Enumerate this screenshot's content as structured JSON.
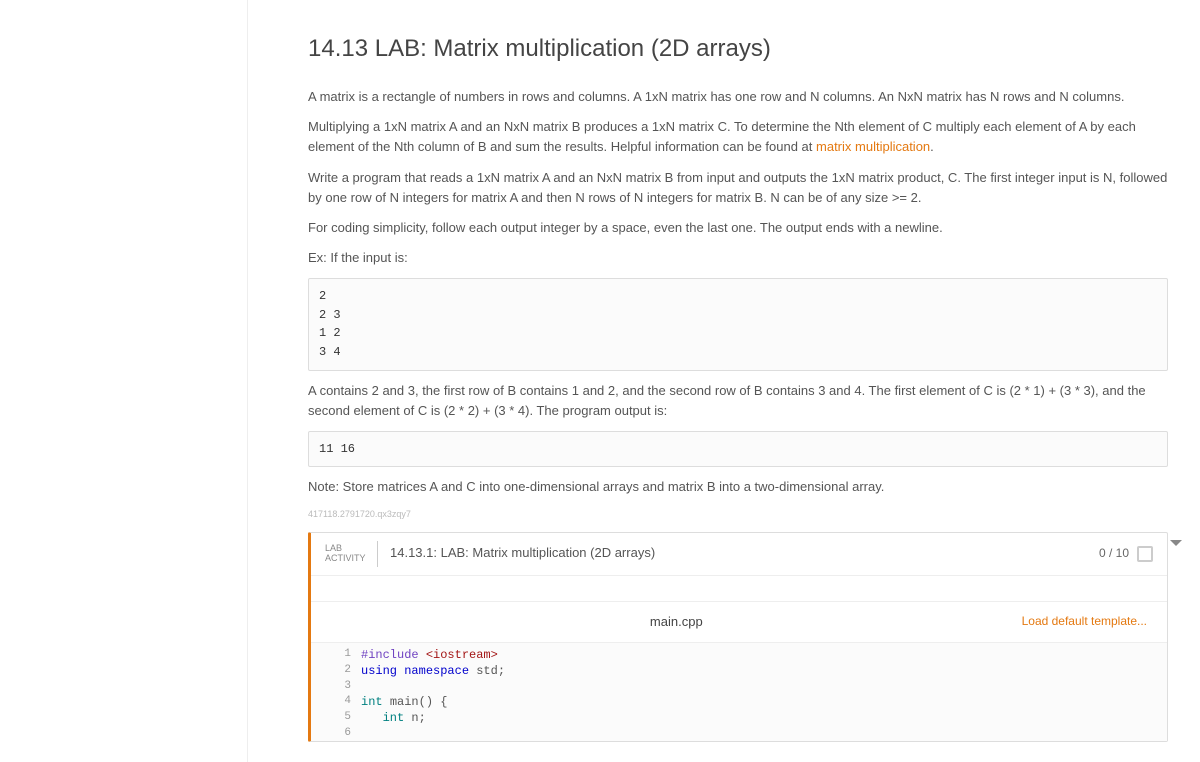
{
  "title": "14.13 LAB: Matrix multiplication (2D arrays)",
  "paragraphs": {
    "p1": "A matrix is a rectangle of numbers in rows and columns. A 1xN matrix has one row and N columns. An NxN matrix has N rows and N columns.",
    "p2_a": "Multiplying a 1xN matrix A and an NxN matrix B produces a 1xN matrix C. To determine the Nth element of C multiply each element of A by each element of the Nth column of B and sum the results. Helpful information can be found at ",
    "p2_link": "matrix multiplication",
    "p2_b": ".",
    "p3": "Write a program that reads a 1xN matrix A and an NxN matrix B from input and outputs the 1xN matrix product, C. The first integer input is N, followed by one row of N integers for matrix A and then N rows of N integers for matrix B. N can be of any size >= 2.",
    "p4": "For coding simplicity, follow each output integer by a space, even the last one. The output ends with a newline.",
    "p5": "Ex: If the input is:",
    "codebox1": "2\n2 3\n1 2\n3 4",
    "p6": "A contains 2 and 3, the first row of B contains 1 and 2, and the second row of B contains 3 and 4. The first element of C is (2 * 1) + (3 * 3), and the second element of C is (2 * 2) + (3 * 4). The program output is:",
    "codebox2": "11 16 ",
    "p7": "Note: Store matrices A and C into one-dimensional arrays and matrix B into a two-dimensional array.",
    "hash": "417118.2791720.qx3zqy7"
  },
  "activity": {
    "label_top": "LAB",
    "label_bottom": "ACTIVITY",
    "title": "14.13.1: LAB: Matrix multiplication (2D arrays)",
    "score": "0 / 10",
    "filename": "main.cpp",
    "load_template": "Load default template..."
  },
  "code": {
    "l1a": "#include ",
    "l1b": "<iostream>",
    "l2a": "using ",
    "l2b": "namespace ",
    "l2c": "std;",
    "l3": "",
    "l4a": "int ",
    "l4b": "main() {",
    "l5a": "   int ",
    "l5b": "n;",
    "l6": ""
  },
  "line_numbers": [
    "1",
    "2",
    "3",
    "4",
    "5",
    "6"
  ]
}
